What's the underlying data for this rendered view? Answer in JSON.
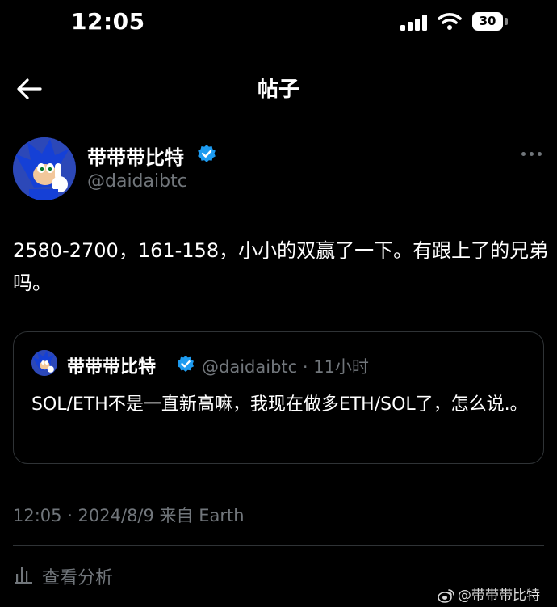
{
  "status_bar": {
    "time": "12:05",
    "battery": "30"
  },
  "nav": {
    "title": "帖子"
  },
  "post": {
    "author": "带带带比特",
    "handle": "@daidaibtc",
    "text": "2580-2700，161-158，小小的双赢了一下。有跟上了的兄弟吗。",
    "timestamp": "12:05 · 2024/8/9 来自 Earth"
  },
  "quote": {
    "author": "带带带比特",
    "meta": "@daidaibtc · 11小时",
    "text": "SOL/ETH不是一直新高嘛，我现在做多ETH/SOL了，怎么说.。"
  },
  "analytics": {
    "label": "查看分析"
  },
  "watermark": "@带带带比特",
  "colors": {
    "verified": "#1d9bf0",
    "muted": "#71767b",
    "background": "#000000"
  },
  "icons": [
    "back-arrow-icon",
    "verified-badge-icon",
    "more-options-icon",
    "analytics-bar-icon",
    "weibo-logo-icon",
    "signal-icon",
    "wifi-icon",
    "battery-icon"
  ]
}
